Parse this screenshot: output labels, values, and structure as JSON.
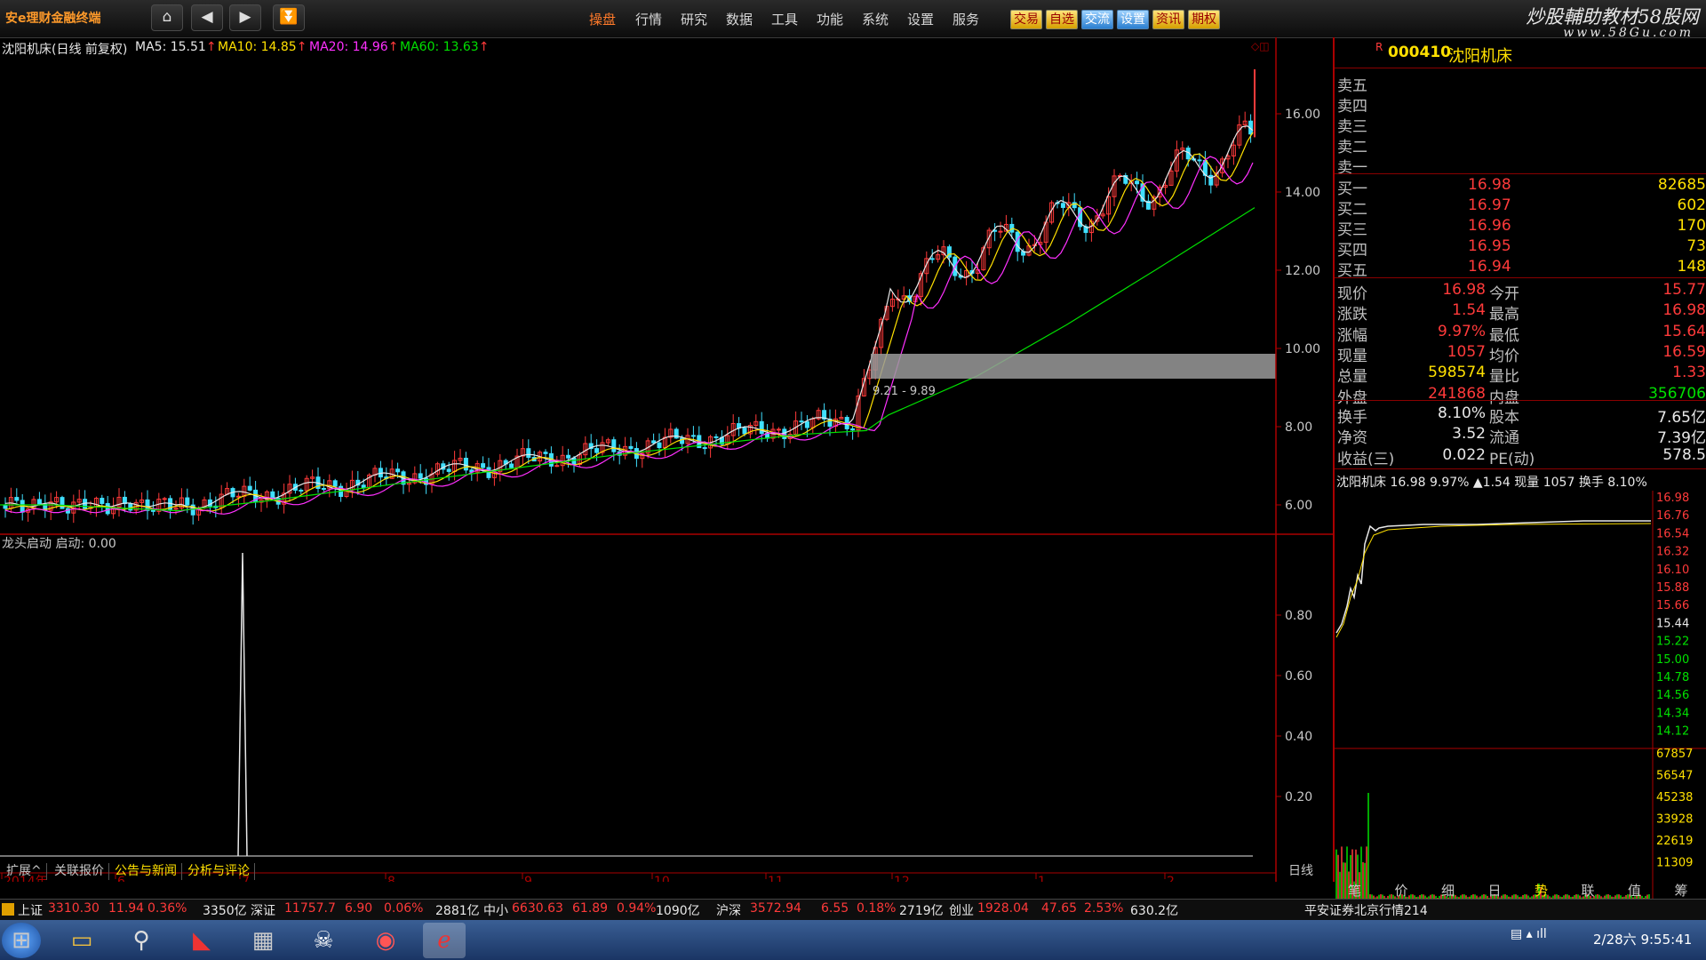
{
  "app": {
    "brand": "安e理财金融终端"
  },
  "watermark": {
    "line1": "炒股輔助教材58股网",
    "line2": "www.58Gu.com"
  },
  "menu": [
    "操盘",
    "行情",
    "研究",
    "数据",
    "工具",
    "功能",
    "系统",
    "设置",
    "服务"
  ],
  "quick_buttons": [
    "交易",
    "自选",
    "交流",
    "设置",
    "资讯",
    "期权"
  ],
  "chart": {
    "stock_label": "沈阳机床(日线 前复权)",
    "ma": [
      {
        "name": "MA5",
        "value": "MA5: 15.51",
        "color": "#e8e8e8"
      },
      {
        "name": "MA10",
        "value": "MA10: 14.85",
        "color": "#ffe000"
      },
      {
        "name": "MA20",
        "value": "MA20: 14.96",
        "color": "#ff30ff"
      },
      {
        "name": "MA60",
        "value": "MA60: 13.63",
        "color": "#00e000"
      }
    ],
    "price_ticks": [
      "16.00",
      "14.00",
      "12.00",
      "10.00",
      "8.00",
      "6.00"
    ],
    "zone_label": "9.21 - 9.89",
    "indicator_label": "龙头启动  启动: 0.00",
    "indicator_ticks": [
      "0.80",
      "0.60",
      "0.40",
      "0.20"
    ],
    "x_ticks": [
      "2014年",
      "6",
      "7",
      "8",
      "9",
      "10",
      "11",
      "12",
      "1",
      "2"
    ],
    "period_label": "日线"
  },
  "quote": {
    "marker": "R",
    "code": "000410",
    "name": "沈阳机床",
    "asks": [
      "卖五",
      "卖四",
      "卖三",
      "卖二",
      "卖一"
    ],
    "bids": [
      {
        "label": "买一",
        "price": "16.98",
        "vol": "82685"
      },
      {
        "label": "买二",
        "price": "16.97",
        "vol": "602"
      },
      {
        "label": "买三",
        "price": "16.96",
        "vol": "170"
      },
      {
        "label": "买四",
        "price": "16.95",
        "vol": "73"
      },
      {
        "label": "买五",
        "price": "16.94",
        "vol": "148"
      }
    ],
    "stats": [
      {
        "l1": "现价",
        "v1": "16.98",
        "c1": "red",
        "l2": "今开",
        "v2": "15.77",
        "c2": "red"
      },
      {
        "l1": "涨跌",
        "v1": "1.54",
        "c1": "red",
        "l2": "最高",
        "v2": "16.98",
        "c2": "red"
      },
      {
        "l1": "涨幅",
        "v1": "9.97%",
        "c1": "red",
        "l2": "最低",
        "v2": "15.64",
        "c2": "red"
      },
      {
        "l1": "现量",
        "v1": "1057",
        "c1": "red",
        "l2": "均价",
        "v2": "16.59",
        "c2": "red"
      },
      {
        "l1": "总量",
        "v1": "598574",
        "c1": "yellow",
        "l2": "量比",
        "v2": "1.33",
        "c2": "red"
      },
      {
        "l1": "外盘",
        "v1": "241868",
        "c1": "red",
        "l2": "内盘",
        "v2": "356706",
        "c2": "green"
      }
    ],
    "stats2": [
      {
        "l1": "换手",
        "v1": "8.10%",
        "l2": "股本",
        "v2": "7.65亿"
      },
      {
        "l1": "净资",
        "v1": "3.52",
        "l2": "流通",
        "v2": "7.39亿"
      },
      {
        "l1": "收益(三)",
        "v1": "0.022",
        "l2": "PE(动)",
        "v2": "578.5"
      }
    ],
    "mini_title": "沈阳机床  16.98  9.97%  ▲1.54  现量 1057  换手 8.10%",
    "mini_price_ticks": [
      "16.98",
      "16.76",
      "16.54",
      "16.32",
      "16.10",
      "15.88",
      "15.66",
      "15.44",
      "15.22",
      "15.00",
      "14.78",
      "14.56",
      "14.34",
      "14.12"
    ],
    "mini_vol_ticks": [
      "67857",
      "56547",
      "45238",
      "33928",
      "22619",
      "11309"
    ],
    "tabs": [
      "笔",
      "价",
      "细",
      "日",
      "势",
      "联",
      "值",
      "筹"
    ]
  },
  "bottom_tabs": [
    "扩展^",
    "关联报价",
    "公告与新闻",
    "分析与评论"
  ],
  "status": [
    {
      "t": "上证",
      "c": "#e8e8e8"
    },
    {
      "t": "3310.30",
      "c": "#ff3a3a"
    },
    {
      "t": "11.94",
      "c": "#ff3a3a"
    },
    {
      "t": "0.36%",
      "c": "#ff3a3a"
    },
    {
      "t": "3350亿",
      "c": "#e8e8e8"
    },
    {
      "t": "深证",
      "c": "#e8e8e8"
    },
    {
      "t": "11757.7",
      "c": "#ff3a3a"
    },
    {
      "t": "6.90",
      "c": "#ff3a3a"
    },
    {
      "t": "0.06%",
      "c": "#ff3a3a"
    },
    {
      "t": "2881亿",
      "c": "#e8e8e8"
    },
    {
      "t": "中小",
      "c": "#e8e8e8"
    },
    {
      "t": "6630.63",
      "c": "#ff3a3a"
    },
    {
      "t": "61.89",
      "c": "#ff3a3a"
    },
    {
      "t": "0.94%",
      "c": "#ff3a3a"
    },
    {
      "t": "1090亿",
      "c": "#e8e8e8"
    },
    {
      "t": "沪深",
      "c": "#e8e8e8"
    },
    {
      "t": "3572.94",
      "c": "#ff3a3a"
    },
    {
      "t": "6.55",
      "c": "#ff3a3a"
    },
    {
      "t": "0.18%",
      "c": "#ff3a3a"
    },
    {
      "t": "2719亿",
      "c": "#e8e8e8"
    },
    {
      "t": "创业",
      "c": "#e8e8e8"
    },
    {
      "t": "1928.04",
      "c": "#ff3a3a"
    },
    {
      "t": "47.65",
      "c": "#ff3a3a"
    },
    {
      "t": "2.53%",
      "c": "#ff3a3a"
    },
    {
      "t": "630.2亿",
      "c": "#e8e8e8"
    }
  ],
  "broker": "平安证券北京行情214",
  "clock": "2/28六 9:55:41",
  "taskbar_icons": [
    "start-orb-icon",
    "folder-icon",
    "search-app-icon",
    "stock-app-icon",
    "calculator-icon",
    "mask-app-icon",
    "color-wheel-icon",
    "ie-browser-icon"
  ]
}
